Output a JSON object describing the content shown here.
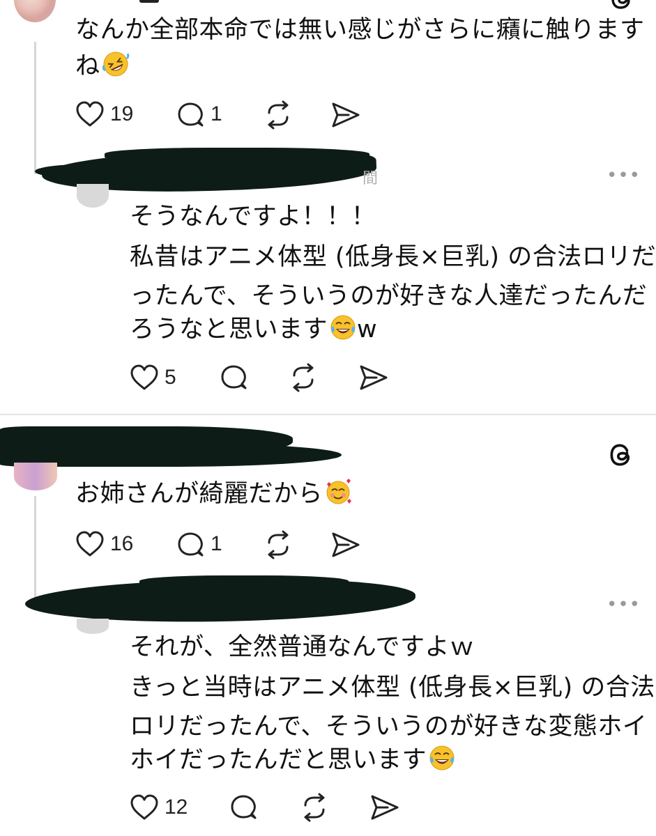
{
  "posts": [
    {
      "lines": [
        "なんか全部本命では無い感じがさらに癪に触ります",
        "ね"
      ],
      "emoji": "rofl-emoji",
      "likes": "19",
      "replies": "1"
    },
    {
      "lines": [
        "そうなんですよ！！！",
        "私昔はアニメ体型 (低身長×巨乳) の合法ロリだ",
        "ったんで、そういうのが好きな人達だったんだ",
        "ろうなと思います"
      ],
      "tail": "w",
      "emoji": "joy-emoji",
      "likes": "5",
      "time_stub": "間"
    },
    {
      "lines": [
        "お姉さんが綺麗だから"
      ],
      "emoji": "smiling-hearts-emoji",
      "likes": "16",
      "replies": "1"
    },
    {
      "lines": [
        "それが、全然普通なんですよｗ",
        "きっと当時はアニメ体型 (低身長×巨乳) の合法",
        "ロリだったんで、そういうのが好きな変態ホイ",
        "ホイだったんだと思います"
      ],
      "emoji": "joy-emoji",
      "likes": "12"
    }
  ],
  "more_menu": "•••",
  "app_icon": "threads-icon",
  "colors": {
    "redaction": "#0d1c17",
    "divider": "#e4e4e4",
    "thread_line": "#d6d6d6"
  }
}
